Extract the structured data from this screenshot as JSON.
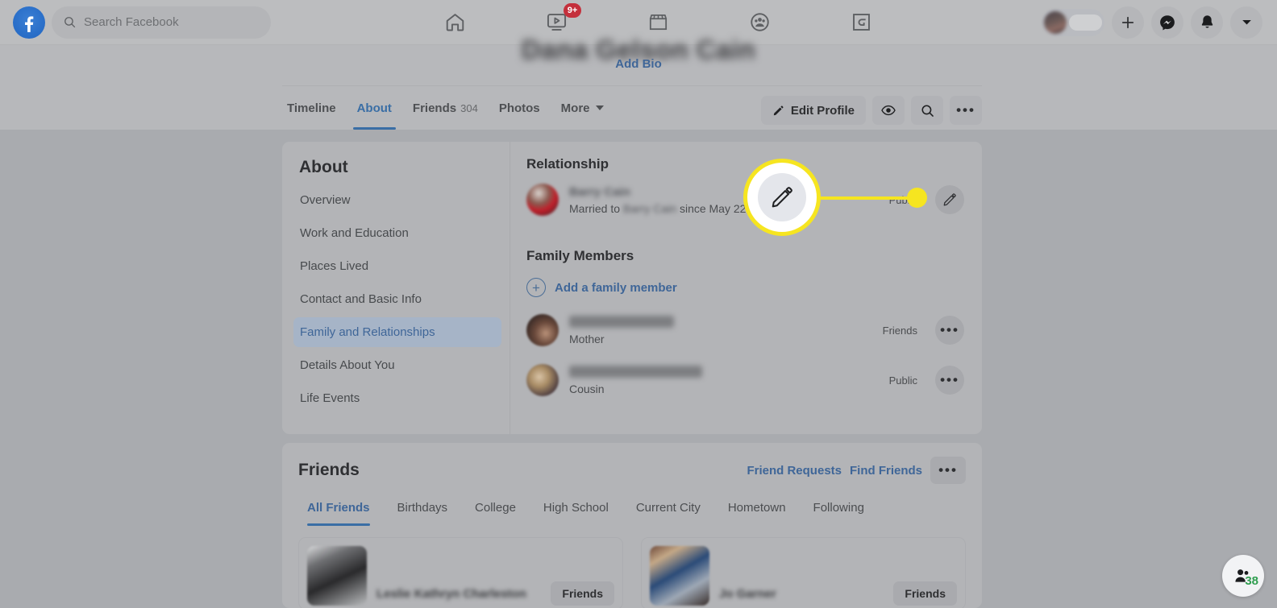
{
  "topbar": {
    "logo": "facebook-logo",
    "search": {
      "placeholder": "Search Facebook",
      "icon": "search-icon"
    },
    "nav": [
      {
        "name": "home",
        "icon": "home-icon",
        "badge": ""
      },
      {
        "name": "video",
        "icon": "video-icon",
        "badge": "9+"
      },
      {
        "name": "marketplace",
        "icon": "marketplace-icon",
        "badge": ""
      },
      {
        "name": "groups",
        "icon": "groups-icon",
        "badge": ""
      },
      {
        "name": "gaming",
        "icon": "gaming-icon",
        "badge": ""
      }
    ],
    "right": [
      {
        "name": "profile-pill",
        "icon": "avatar-icon"
      },
      {
        "name": "create",
        "icon": "plus-icon"
      },
      {
        "name": "messenger",
        "icon": "messenger-icon"
      },
      {
        "name": "notifications",
        "icon": "bell-icon"
      },
      {
        "name": "account",
        "icon": "chevron-down-icon"
      }
    ]
  },
  "profile": {
    "name": "",
    "add_bio": "Add Bio",
    "tabs": [
      {
        "label": "Timeline",
        "count": "",
        "active": false
      },
      {
        "label": "About",
        "count": "",
        "active": true
      },
      {
        "label": "Friends",
        "count": "304",
        "active": false
      },
      {
        "label": "Photos",
        "count": "",
        "active": false
      },
      {
        "label": "More",
        "count": "",
        "active": false,
        "caret": true
      }
    ],
    "edit_profile": "Edit Profile",
    "view_as_icon": "eye-icon",
    "search_icon": "search-icon",
    "more_icon": "ellipsis-icon"
  },
  "about": {
    "title": "About",
    "items": [
      {
        "label": "Overview",
        "active": false
      },
      {
        "label": "Work and Education",
        "active": false
      },
      {
        "label": "Places Lived",
        "active": false
      },
      {
        "label": "Contact and Basic Info",
        "active": false
      },
      {
        "label": "Family and Relationships",
        "active": true
      },
      {
        "label": "Details About You",
        "active": false
      },
      {
        "label": "Life Events",
        "active": false
      }
    ],
    "relationship": {
      "heading": "Relationship",
      "partner_name": "",
      "status_prefix": "Married to ",
      "status_name": "",
      "status_suffix": " since May 22, 200",
      "privacy": "Public",
      "edit_icon": "pencil-icon"
    },
    "family": {
      "heading": "Family Members",
      "add_label": "Add a family member",
      "add_icon": "plus-circle-icon",
      "members": [
        {
          "name": "",
          "relation": "Mother",
          "privacy": "Friends",
          "menu_icon": "ellipsis-icon"
        },
        {
          "name": "",
          "relation": "Cousin",
          "privacy": "Public",
          "menu_icon": "ellipsis-icon"
        }
      ]
    }
  },
  "friends": {
    "title": "Friends",
    "friend_requests": "Friend Requests",
    "find_friends": "Find Friends",
    "more_icon": "ellipsis-icon",
    "tabs": [
      {
        "label": "All Friends",
        "active": true
      },
      {
        "label": "Birthdays",
        "active": false
      },
      {
        "label": "College",
        "active": false
      },
      {
        "label": "High School",
        "active": false
      },
      {
        "label": "Current City",
        "active": false
      },
      {
        "label": "Hometown",
        "active": false
      },
      {
        "label": "Following",
        "active": false
      }
    ],
    "cards": [
      {
        "name": "Leslie Kathryn Charleston",
        "button": "Friends"
      },
      {
        "name": "Jo Garner",
        "button": "Friends"
      }
    ]
  },
  "callout": {
    "icon": "pencil-icon",
    "highlight_color": "#f6e520"
  },
  "chat": {
    "icon": "contacts-icon",
    "count": "38",
    "count_color": "#2f9e4f"
  }
}
